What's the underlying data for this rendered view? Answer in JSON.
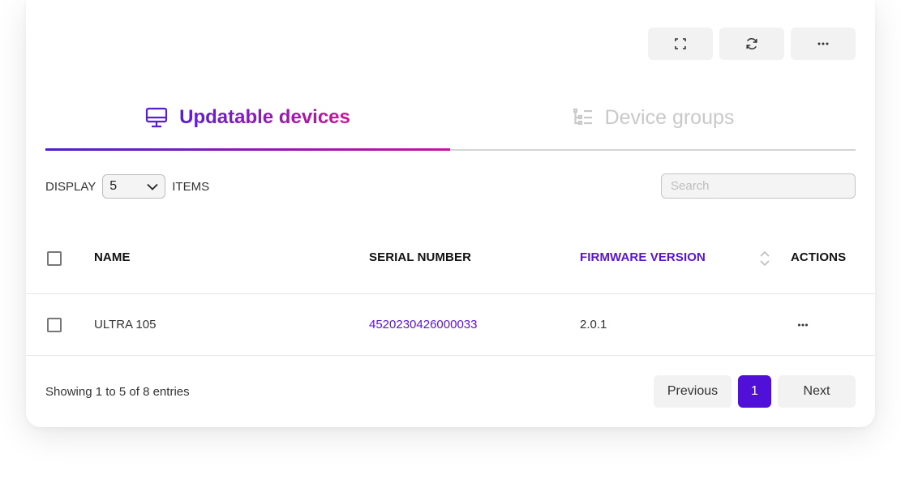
{
  "toolbar": {
    "buttons": [
      {
        "icon": "fullscreen-icon"
      },
      {
        "icon": "refresh-icon"
      },
      {
        "icon": "more-horizontal-icon"
      }
    ]
  },
  "tabs": [
    {
      "label": "Updatable devices",
      "icon": "monitor-icon",
      "active": true
    },
    {
      "label": "Device groups",
      "icon": "list-tree-icon",
      "active": false
    }
  ],
  "display": {
    "prefix": "DISPLAY",
    "value": "5",
    "suffix": "ITEMS"
  },
  "search": {
    "placeholder": "Search",
    "value": ""
  },
  "table": {
    "columns": [
      "NAME",
      "SERIAL NUMBER",
      "FIRMWARE VERSION",
      "ACTIONS"
    ],
    "sorted_column": "FIRMWARE VERSION",
    "rows": [
      {
        "name": "ULTRA 105",
        "serial": "4520230426000033",
        "firmware": "2.0.1"
      }
    ]
  },
  "footer": {
    "entries_text": "Showing 1 to 5 of 8 entries",
    "pagination": {
      "previous": "Previous",
      "current": "1",
      "next": "Next"
    }
  },
  "colors": {
    "accent": "#5a14d6",
    "accent_gradient_end": "#c8149a",
    "page_active": "#5010d8"
  }
}
